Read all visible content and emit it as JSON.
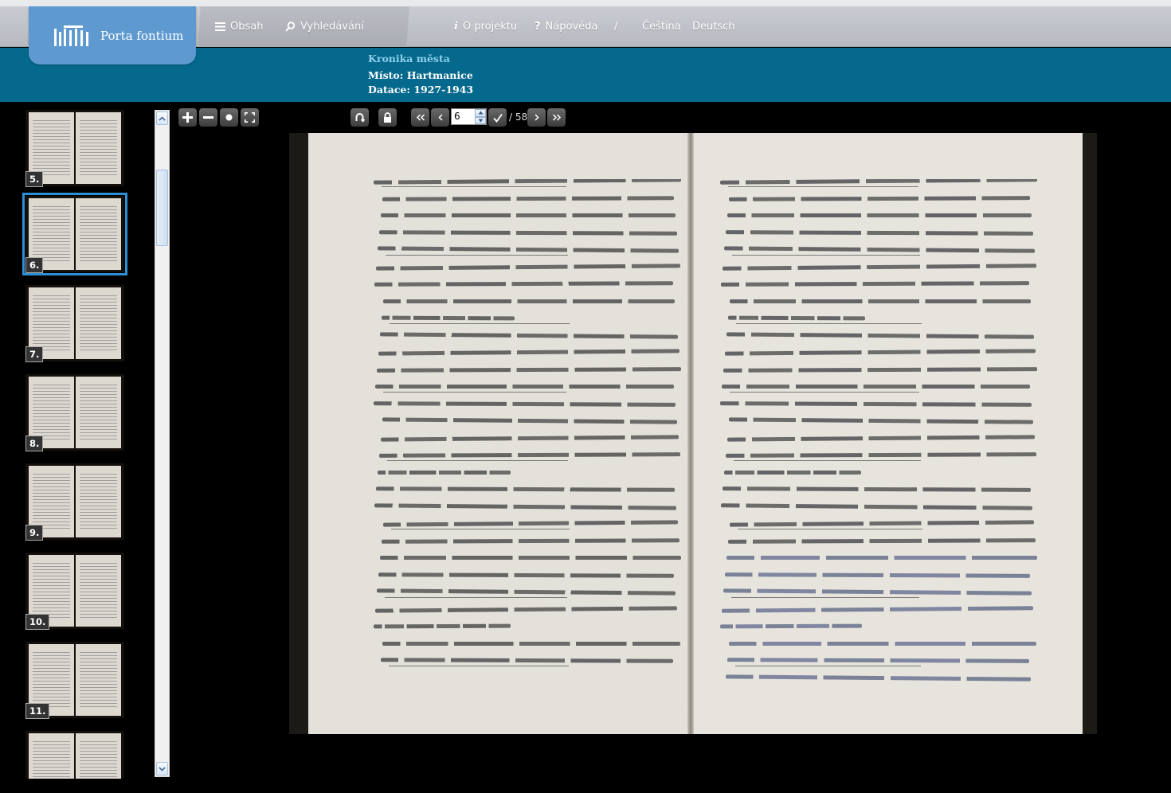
{
  "app": {
    "logo_text": "Porta fontium"
  },
  "nav": {
    "contents": "Obsah",
    "search": "Vyhledávání",
    "about": "O projektu",
    "help": "Nápověda",
    "separator": "/",
    "lang_cs": "Čeština",
    "lang_de": "Deutsch"
  },
  "document": {
    "title": "Kronika města",
    "place": "Místo: Hartmanice",
    "date": "Datace: 1927-1943"
  },
  "thumbnails": [
    "5.",
    "6.",
    "7.",
    "8.",
    "9.",
    "10.",
    "11.",
    ""
  ],
  "selected_thumbnail": "6.",
  "viewer": {
    "current_page": "6",
    "total_pages": "/ 58"
  },
  "colors": {
    "header_blue": "#05698d",
    "logo_blue": "#5e9ad0",
    "selection": "#2d8fd5"
  }
}
